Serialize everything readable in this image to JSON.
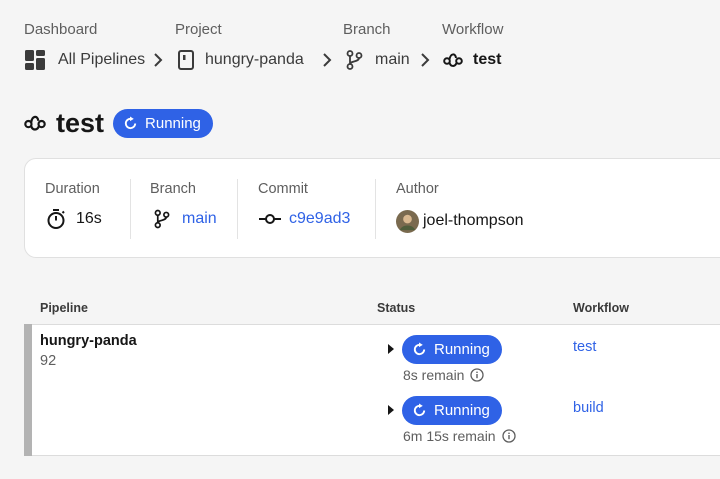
{
  "breadcrumb": {
    "dashboard_label": "Dashboard",
    "dashboard_value": "All Pipelines",
    "project_label": "Project",
    "project_value": "hungry-panda",
    "branch_label": "Branch",
    "branch_value": "main",
    "workflow_label": "Workflow",
    "workflow_value": "test"
  },
  "header": {
    "title": "test",
    "status": "Running"
  },
  "summary": {
    "duration_label": "Duration",
    "duration_value": "16s",
    "branch_label": "Branch",
    "branch_value": "main",
    "commit_label": "Commit",
    "commit_value": "c9e9ad3",
    "author_label": "Author",
    "author_value": "joel-thompson"
  },
  "table": {
    "headers": [
      "Pipeline",
      "Status",
      "Workflow"
    ],
    "pipeline_name": "hungry-panda",
    "pipeline_number": "92",
    "workflows": [
      {
        "status": "Running",
        "remain": "8s remain",
        "name": "test"
      },
      {
        "status": "Running",
        "remain": "6m 15s remain",
        "name": "build"
      }
    ]
  },
  "colors": {
    "accent": "#2f62e6",
    "background": "#f5f5f5",
    "row_accent": "#b3b3b3"
  }
}
